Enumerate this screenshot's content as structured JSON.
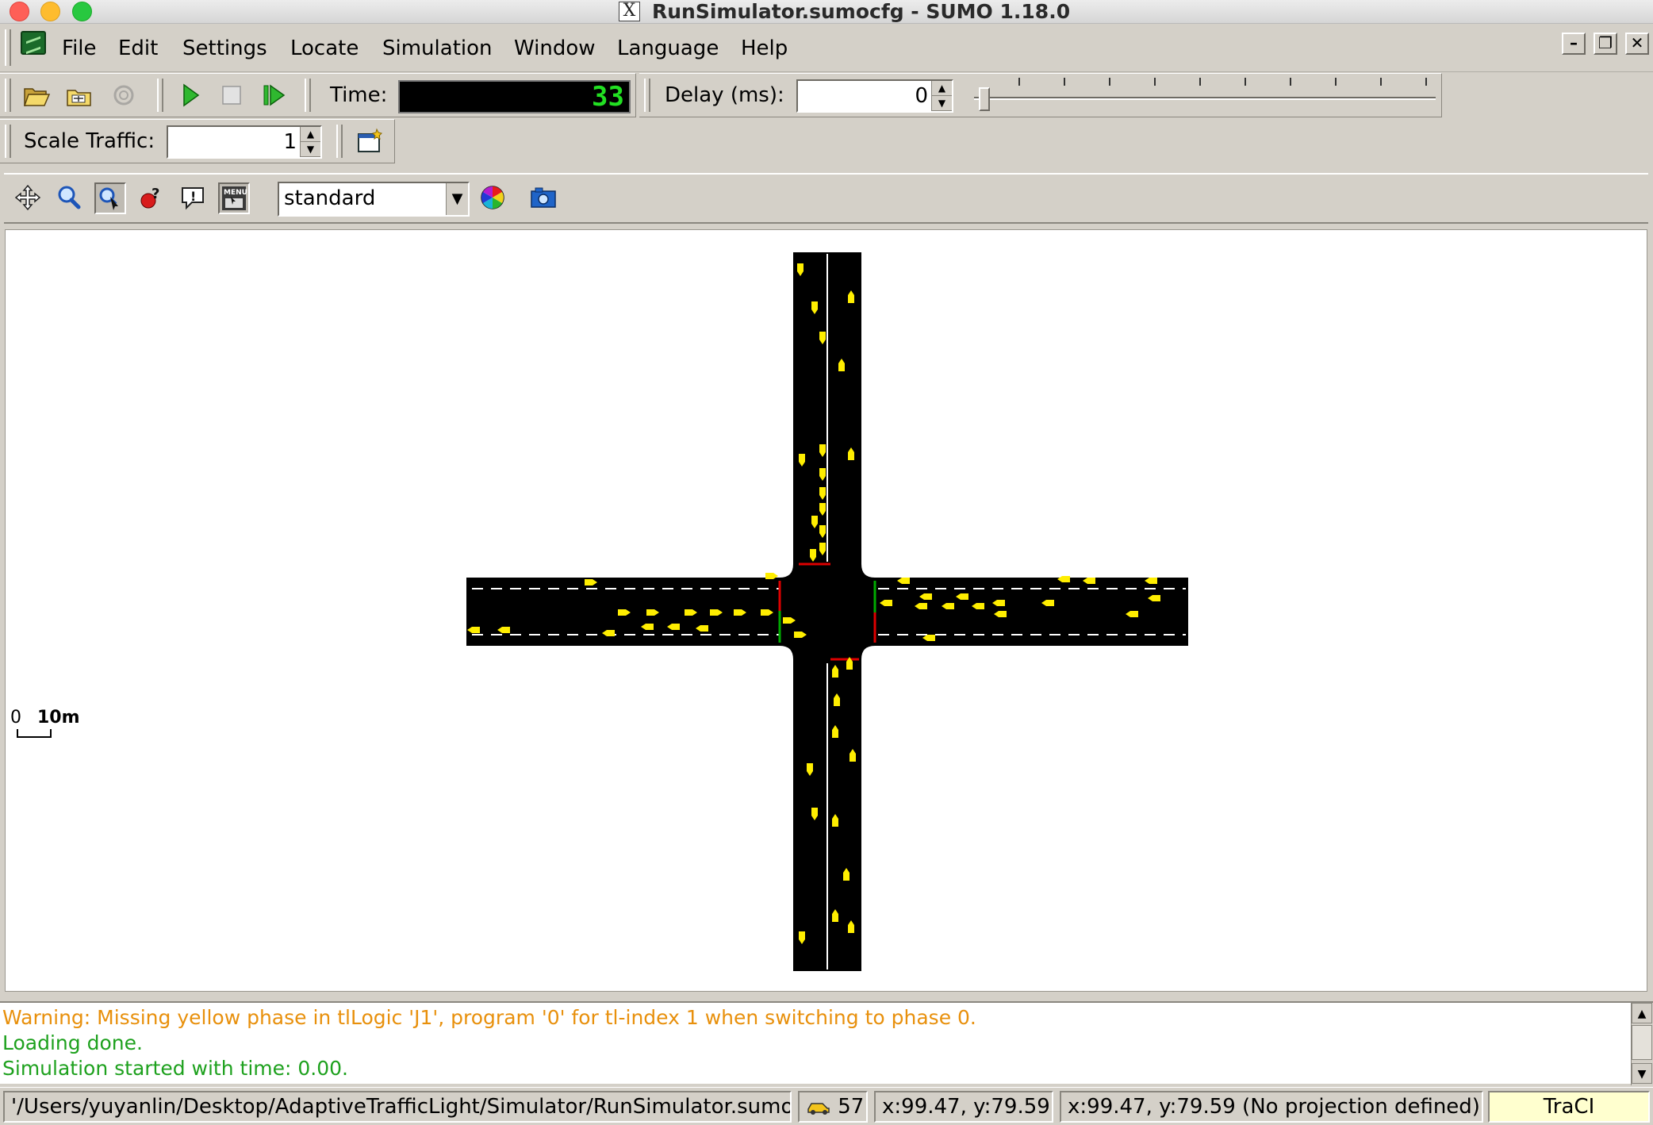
{
  "window": {
    "title": "RunSimulator.sumocfg - SUMO 1.18.0",
    "x_icon": "X"
  },
  "menu": {
    "items": [
      {
        "label": "File"
      },
      {
        "label": "Edit"
      },
      {
        "label": "Settings"
      },
      {
        "label": "Locate"
      },
      {
        "label": "Simulation"
      },
      {
        "label": "Window"
      },
      {
        "label": "Language"
      },
      {
        "label": "Help"
      }
    ]
  },
  "toolbar": {
    "time_label": "Time:",
    "time_value": "33",
    "delay_label": "Delay (ms):",
    "delay_value": "0",
    "delay_slider_fraction": 0.0,
    "scale_label": "Scale Traffic:",
    "scale_value": "1"
  },
  "viewbar": {
    "scheme_selected": "standard"
  },
  "canvas": {
    "scale_zero": "0",
    "scale_label": "10m"
  },
  "log": {
    "lines": [
      {
        "text": "Warning: Missing yellow phase in tlLogic 'J1', program '0' for tl-index 1 when switching to phase 0.",
        "kind": "warning"
      },
      {
        "text": "Loading done.",
        "kind": "info"
      },
      {
        "text": "Simulation started with time: 0.00.",
        "kind": "info"
      }
    ]
  },
  "statusbar": {
    "config_path": "'/Users/yuyanlin/Desktop/AdaptiveTrafficLight/Simulator/RunSimulator.sumocfg'",
    "vehicle_count": "57",
    "coords": "x:99.47, y:79.59",
    "geo_coords": "x:99.47, y:79.59 (No projection defined)",
    "traci": "TraCI"
  },
  "colors": {
    "road": "#000000",
    "vehicle": "#ffee00",
    "warning_text": "#e8900c",
    "info_text": "#1ea11e",
    "time_digits": "#22e022",
    "traci_bg": "#ffffcf"
  }
}
